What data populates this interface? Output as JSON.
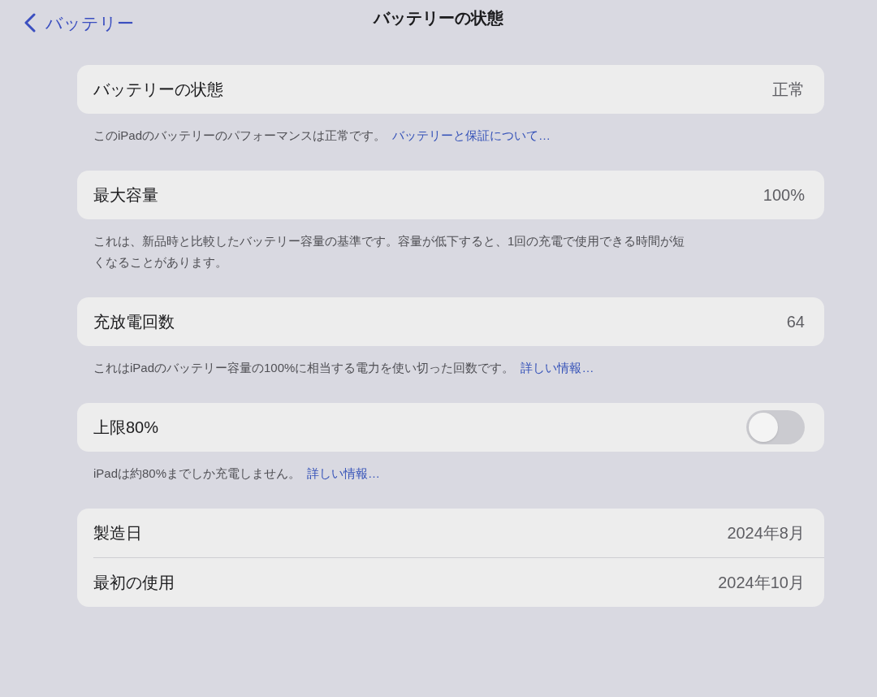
{
  "nav": {
    "back": "バッテリー",
    "title": "バッテリーの状態"
  },
  "sections": [
    {
      "rows": [
        {
          "kind": "value",
          "label": "バッテリーの状態",
          "value": "正常"
        }
      ],
      "footer": {
        "text": "このiPadのバッテリーのパフォーマンスは正常です。",
        "link": "バッテリーと保証について…"
      }
    },
    {
      "rows": [
        {
          "kind": "value",
          "label": "最大容量",
          "value": "100%"
        }
      ],
      "footer": {
        "text": "これは、新品時と比較したバッテリー容量の基準です。容量が低下すると、1回の充電で使用できる時間が短くなることがあります。"
      }
    },
    {
      "rows": [
        {
          "kind": "value",
          "label": "充放電回数",
          "value": "64"
        }
      ],
      "footer": {
        "text": "これはiPadのバッテリー容量の100%に相当する電力を使い切った回数です。",
        "link": "詳しい情報…"
      }
    },
    {
      "rows": [
        {
          "kind": "toggle",
          "label": "上限80%",
          "on": false
        }
      ],
      "footer": {
        "text": "iPadは約80%までしか充電しません。",
        "link": "詳しい情報…"
      }
    },
    {
      "rows": [
        {
          "kind": "value",
          "label": "製造日",
          "value": "2024年8月"
        },
        {
          "kind": "value",
          "label": "最初の使用",
          "value": "2024年10月"
        }
      ]
    }
  ]
}
